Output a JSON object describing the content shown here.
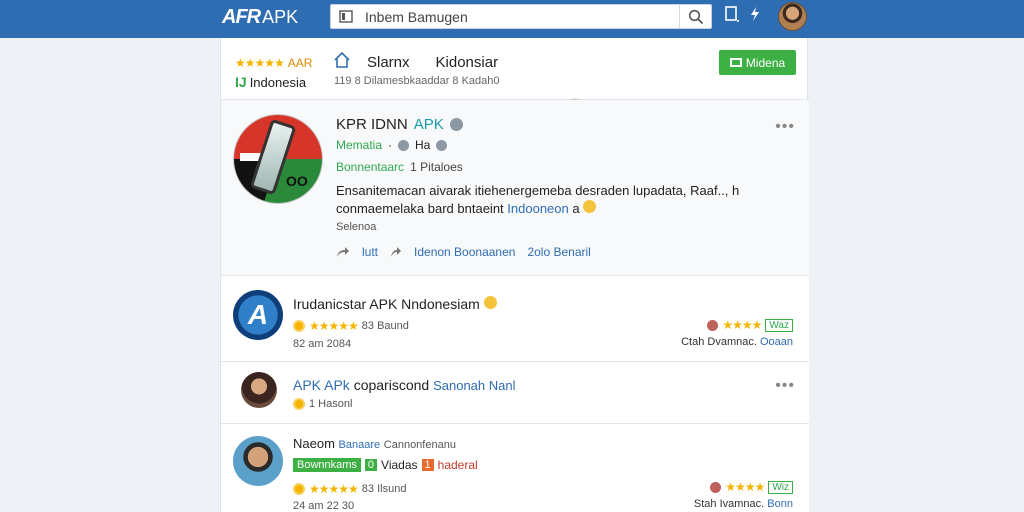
{
  "topbar": {
    "logo_mark": "AFR",
    "logo_text": "APK",
    "search_placeholder": "Inbem Bamugen"
  },
  "header": {
    "stars": "★★★★★",
    "brand_short": "AAR",
    "country": "Indonesia",
    "tabs": [
      "Slarnx",
      "Kidonsiar"
    ],
    "nav_sub": "119 8 Dilamesbkaaddar 8 Kadah0",
    "action_button": "Midena"
  },
  "app": {
    "title": "KPR IDNN",
    "title_accent": "APK",
    "meta_status": "Mematia",
    "meta_sep": "·",
    "meta_text": "Ha",
    "line3_a": "Bonnentaarc",
    "line3_b": "1 Pitaloes",
    "desc_line1": "Ensanitemacan aivarak itiehenergemeba desraden lupadata, Raaf.., h",
    "desc_line2_a": "conmaemelaka bard bntaeint",
    "desc_line2_link": "Indooneon",
    "desc_line2_b": "a",
    "desc_sub": "Selenoa",
    "actions": [
      {
        "label": "lutt",
        "style": "link"
      },
      {
        "label": "Idenon Boonaanen",
        "style": "link"
      },
      {
        "label": "2olo Benaril",
        "style": "link"
      }
    ]
  },
  "items": [
    {
      "name": "Irudanicstar APK Nndonesiam",
      "stars": "★★★★★",
      "count": "83 Baund",
      "time": "82 am 2084",
      "right_stars": "★★★★",
      "right_tag": "Waz",
      "right_text": "Ctah Dvamnac.",
      "right_link": "Ooaan"
    },
    {
      "name_a": "APK APk",
      "name_b": "copariscond",
      "name_link": "Sanonah Nanl",
      "count": "1 Hasonl"
    },
    {
      "name": "Naeom",
      "name_link": "Banaare",
      "name_sub": "Cannonfenanu",
      "badge_green": "Bownnkams",
      "badge_small": "0",
      "badge_label": "Viadas",
      "badge_orange": "1",
      "badge_orange_text": "haderal",
      "stars": "★★★★★",
      "count": "83 Ilsund",
      "time": "24 am 22 30",
      "right_stars": "★★★★",
      "right_tag": "Wiz",
      "right_text": "Stah Ivamnac.",
      "right_link": "Bonn"
    }
  ]
}
